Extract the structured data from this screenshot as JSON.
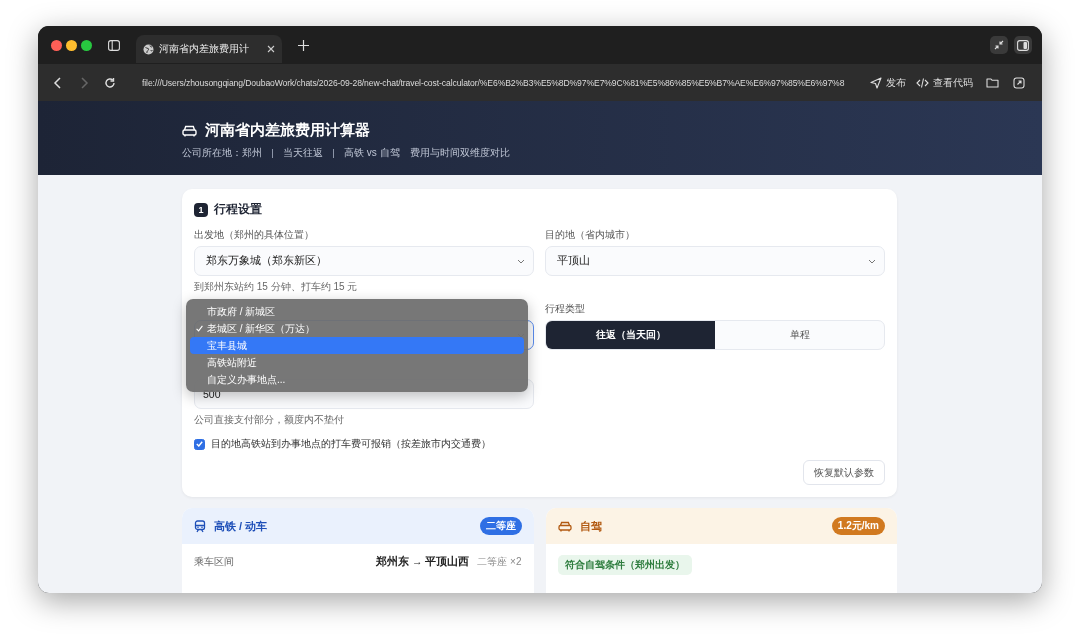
{
  "browser": {
    "tab": {
      "title": "河南省内差旅费用计"
    },
    "nav": [
      {
        "kind": "back",
        "disabled": false
      },
      {
        "kind": "forward",
        "disabled": true
      },
      {
        "kind": "reload",
        "disabled": false
      }
    ],
    "address": "file:///Users/zhousongqiang/DoubaoWork/chats/2026-09-28/new-chat/travel-cost-calculator/%E6%B2%B3%E5%8D%97%E7%9C%81%E5%86%85%E5%B7%AE%E6%97%85%E6%97%8",
    "actions": [
      {
        "kind": "publish",
        "label": "发布"
      },
      {
        "kind": "code",
        "label": "查看代码"
      },
      {
        "kind": "folder"
      },
      {
        "kind": "external"
      }
    ]
  },
  "header": {
    "title": "河南省内差旅费用计算器",
    "subtitle": [
      "公司所在地：郑州",
      "当天往返",
      "高铁 vs 自驾"
    ],
    "note": "费用与时间双维度对比"
  },
  "trip": {
    "step": "1",
    "title": "行程设置",
    "origin": {
      "label": "出发地（郑州的具体位置）",
      "value": "郑东万象城（郑东新区）",
      "hint": "到郑州东站约 15 分钟、打车约 15 元"
    },
    "destination": {
      "label": "目的地（省内城市）",
      "value": "平顶山"
    },
    "venue": {
      "focused": true
    },
    "trip_type": {
      "label": "行程类型",
      "options": [
        {
          "label": "往返（当天回）",
          "selected": true
        },
        {
          "label": "单程",
          "selected": false
        }
      ]
    },
    "budget": {
      "value": "500",
      "hint": "公司直接支付部分，额度内不垫付"
    },
    "reimburse": {
      "label": "目的地高铁站到办事地点的打车费可报销（按差旅市内交通费）",
      "checked": true
    },
    "reset": "恢复默认参数"
  },
  "dropdown": {
    "options": [
      {
        "label": "市政府 / 新城区",
        "checked": false,
        "highlighted": false
      },
      {
        "label": "老城区 / 新华区（万达）",
        "checked": true,
        "highlighted": false
      },
      {
        "label": "宝丰县城",
        "checked": false,
        "highlighted": true
      },
      {
        "label": "高铁站附近",
        "checked": false,
        "highlighted": false
      },
      {
        "label": "自定义办事地点...",
        "checked": false,
        "highlighted": false
      }
    ]
  },
  "results": [
    {
      "kind": "train",
      "title": "高铁 / 动车",
      "badge": "二等座",
      "rows": [
        {
          "label": "乘车区间",
          "value": "郑州东 → 平顶山西",
          "note": "二等座 ×2"
        }
      ]
    },
    {
      "kind": "car",
      "title": "自驾",
      "badge": "1.2元/km",
      "tags": [
        "符合自驾条件（郑州出发）"
      ]
    }
  ]
}
